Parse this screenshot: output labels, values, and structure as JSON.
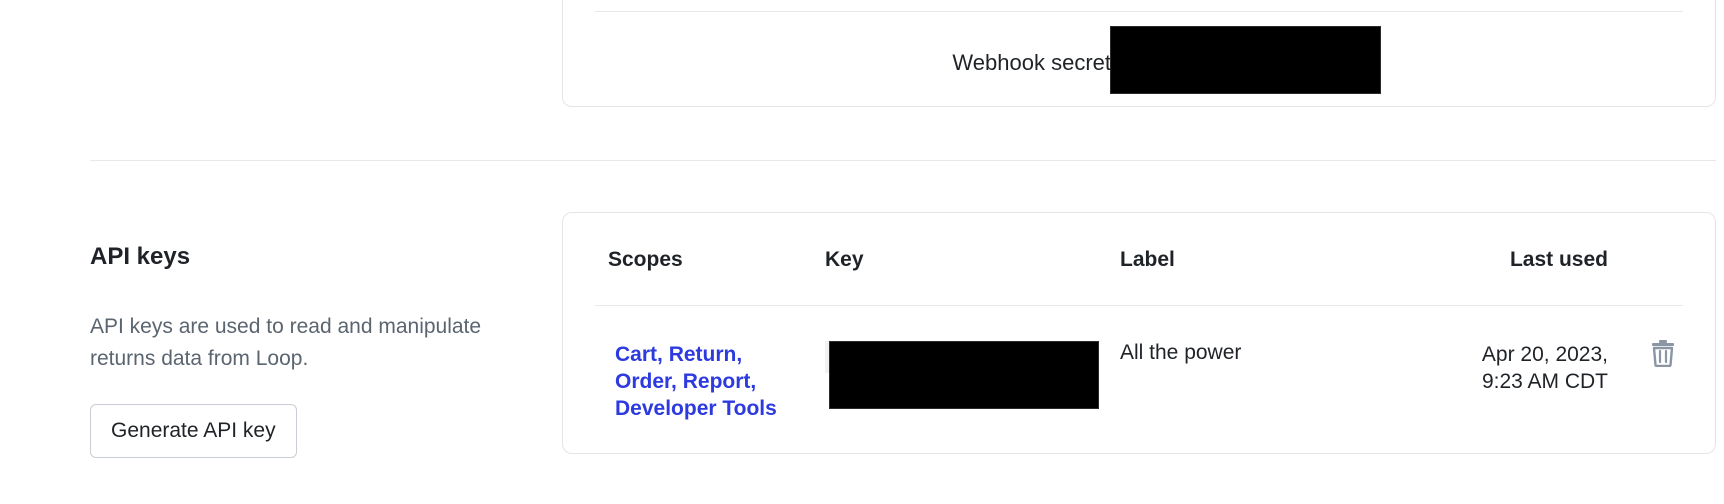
{
  "webhook": {
    "secret_label": "Webhook secret"
  },
  "api_keys_section": {
    "title": "API keys",
    "description": "API keys are used to read and manipulate returns data from Loop.",
    "generate_button_label": "Generate API key"
  },
  "api_keys_table": {
    "headers": {
      "scopes": "Scopes",
      "key": "Key",
      "label": "Label",
      "last_used": "Last used"
    },
    "rows": [
      {
        "scopes": [
          "Cart,",
          "Return,",
          "Order,",
          "Report,",
          "Developer Tools"
        ],
        "label": "All the power",
        "last_used_date": "Apr 20, 2023,",
        "last_used_time": "9:23 AM CDT"
      }
    ]
  },
  "icons": {
    "delete": "trash-icon"
  },
  "colors": {
    "link": "#2d3adf",
    "muted_text": "#5b6570",
    "icon": "#8a96a3",
    "border": "#e3e5e8"
  }
}
